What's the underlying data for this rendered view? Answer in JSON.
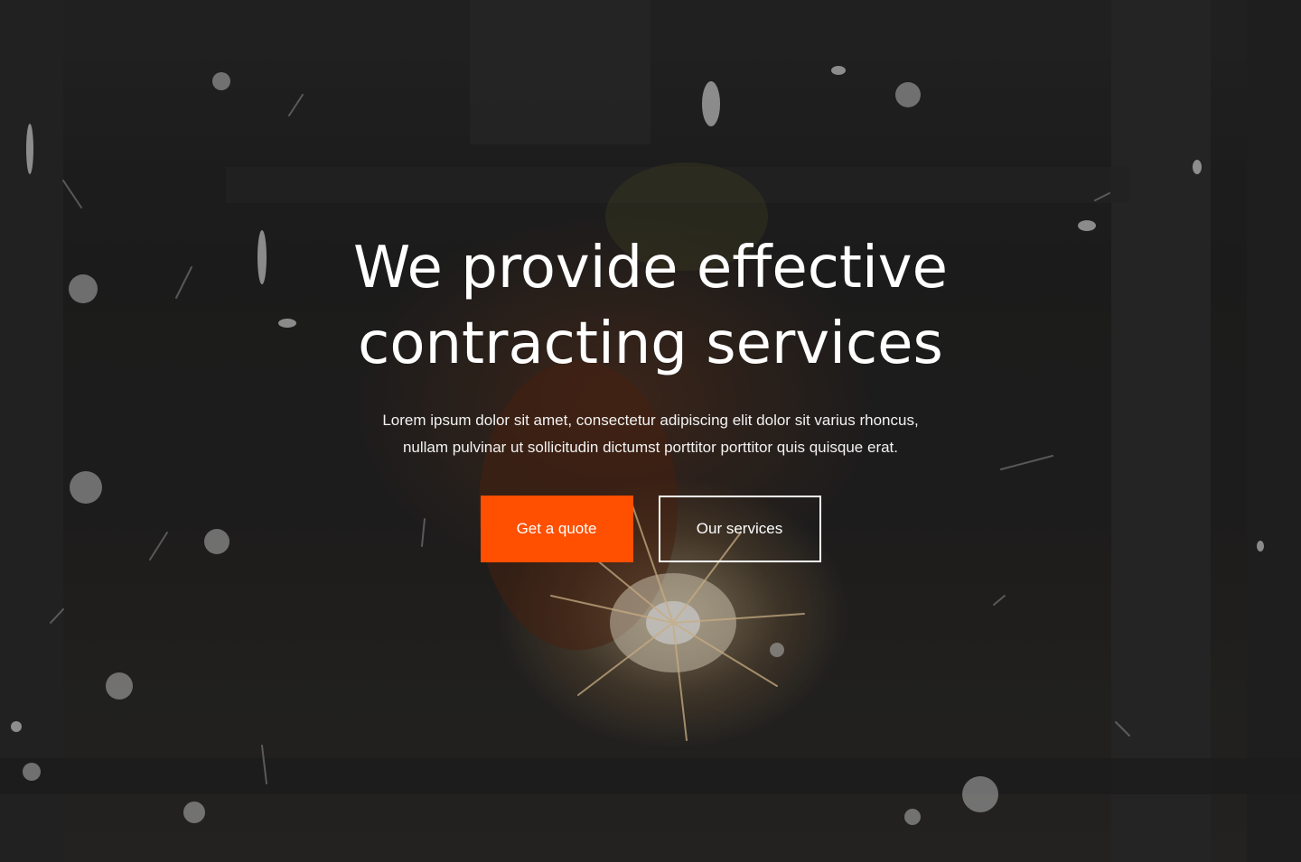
{
  "hero": {
    "title_line1": "We provide effective",
    "title_line2": "contracting services",
    "subtitle_line1": "Lorem ipsum dolor sit amet, consectetur adipiscing elit dolor sit varius rhoncus,",
    "subtitle_line2": "nullam pulvinar ut sollicitudin dictumst porttitor porttitor quis quisque erat.",
    "primary_button_label": "Get a quote",
    "secondary_button_label": "Our services"
  },
  "colors": {
    "accent": "#ff4f00",
    "text": "#ffffff",
    "overlay": "#232323"
  },
  "background_image": "welding-sparks-photo"
}
